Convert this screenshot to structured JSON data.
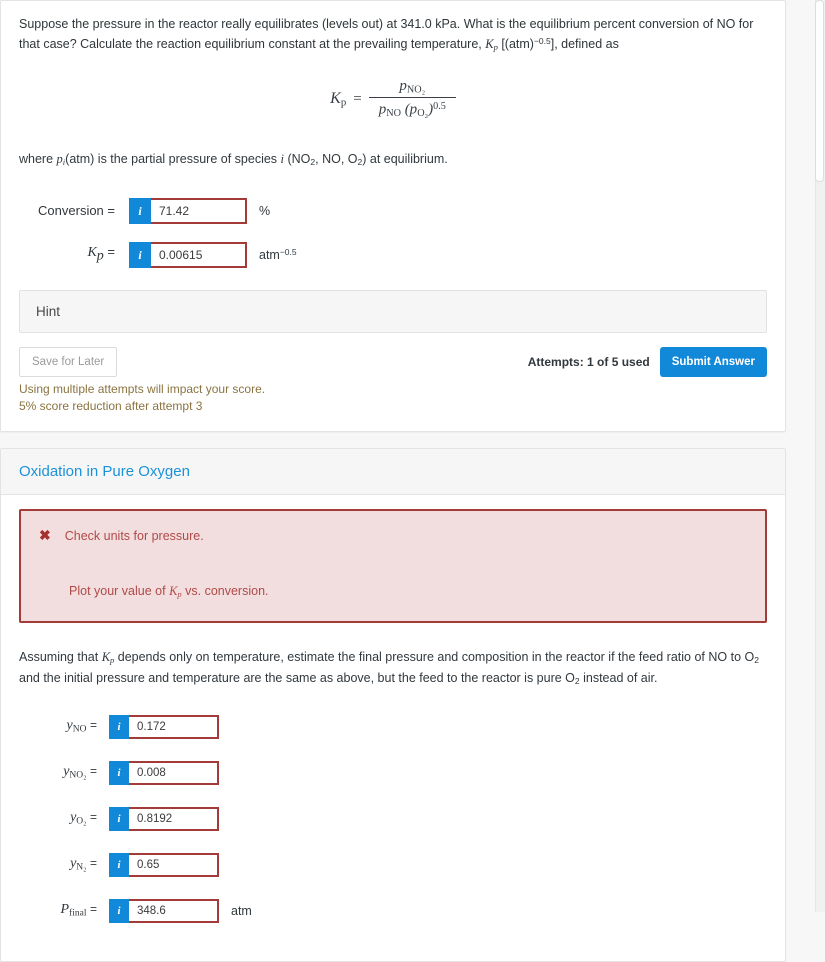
{
  "question1": {
    "prompt_part1": "Suppose the pressure in the reactor really equilibrates (levels out) at 341.0 kPa. What is the equilibrium percent conversion of NO for that case? Calculate the reaction equilibrium constant at the prevailing temperature, ",
    "prompt_kp": "K",
    "prompt_kp_sub": "p",
    "prompt_part2": " [(atm)",
    "prompt_exp": "−0.5",
    "prompt_part3": "], defined as",
    "formula": {
      "lhs": "K",
      "lhs_sub": "p",
      "equals": "=",
      "numerator": "p",
      "numerator_sub": "NO₂",
      "den_left": "p",
      "den_left_sub": "NO",
      "den_right_open": "(p",
      "den_right_sub": "O₂",
      "den_right_close": ")",
      "den_exp": "0.5"
    },
    "where_pre": "where ",
    "where_p": "p",
    "where_p_sub": "i",
    "where_post": "(atm) is the partial pressure of species ",
    "where_i": "i",
    "where_species_open": " (NO",
    "where_species_2a": "2",
    "where_species_mid": ", NO, O",
    "where_species_2b": "2",
    "where_species_close": ") at equilibrium.",
    "fields": [
      {
        "label_text": "Conversion =",
        "label_is_math": false,
        "icon": "info-icon",
        "value": "71.42",
        "unit_text": "%",
        "unit_sup": ""
      },
      {
        "label_text": "K",
        "label_sub": "p",
        "label_eq": "=",
        "label_is_math": true,
        "icon": "info-icon",
        "value": "0.00615",
        "unit_text": "atm",
        "unit_sup": "−0.5"
      }
    ],
    "hint_label": "Hint",
    "save_label": "Save for Later",
    "attempts_label": "Attempts: 1 of 5 used",
    "submit_label": "Submit Answer",
    "warn_line1": "Using multiple attempts will impact your score.",
    "warn_line2": "5% score reduction after attempt 3"
  },
  "question2": {
    "header_title": "Oxidation in Pure Oxygen",
    "alert": {
      "icon": "x-mark-icon",
      "line1": "Check units for pressure.",
      "line2_pre": "Plot your value of ",
      "line2_kp": "K",
      "line2_kp_sub": "p",
      "line2_post": " vs. conversion."
    },
    "para_pre": "Assuming that ",
    "para_kp": "K",
    "para_kp_sub": "p",
    "para_mid1": " depends only on temperature, estimate the final pressure and composition in the reactor if the feed ratio of NO to O",
    "para_sub1": "2",
    "para_mid2": " and the initial pressure and temperature are the same as above, but the feed to the reactor is pure O",
    "para_sub2": "2",
    "para_end": " instead of air.",
    "fields": [
      {
        "var": "y",
        "sub": "NO",
        "eq": "=",
        "icon": "info-icon",
        "value": "0.172",
        "unit": ""
      },
      {
        "var": "y",
        "sub": "NO₂",
        "eq": "=",
        "icon": "info-icon",
        "value": "0.008",
        "unit": ""
      },
      {
        "var": "y",
        "sub": "O₂",
        "eq": "=",
        "icon": "info-icon",
        "value": "0.8192",
        "unit": ""
      },
      {
        "var": "y",
        "sub": "N₂",
        "eq": "=",
        "icon": "info-icon",
        "value": "0.65",
        "unit": ""
      },
      {
        "var": "P",
        "sub": "final",
        "eq": "=",
        "icon": "info-icon",
        "value": "348.6",
        "unit": "atm"
      }
    ]
  },
  "colors": {
    "accent_blue": "#1289d8",
    "heading_blue": "#1b92d8",
    "error_border": "#a33c38",
    "error_bg": "#f2dede",
    "error_text": "#b04a48",
    "warn_text": "#8a7440",
    "input_border": "#a33c38"
  },
  "icons": {
    "info": "i",
    "x_mark": "✖"
  }
}
